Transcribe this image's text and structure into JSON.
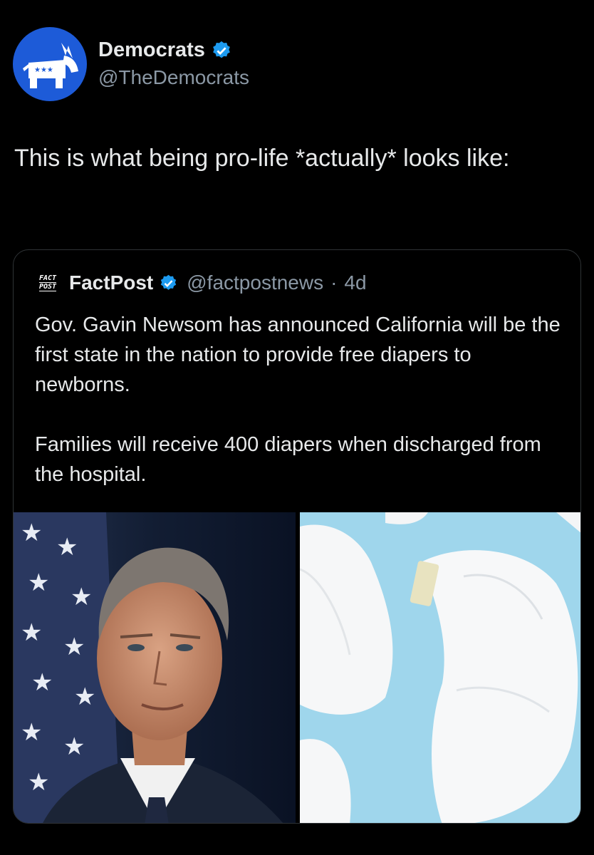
{
  "author": {
    "display_name": "Democrats",
    "handle": "@TheDemocrats",
    "verified": true,
    "avatar_icon": "donkey-logo-icon",
    "avatar_color": "#1d5bd8"
  },
  "tweet": {
    "text": "This is what being pro-life *actually* looks like:"
  },
  "quote": {
    "logo_lines": [
      "FACT",
      "POST"
    ],
    "display_name": "FactPost",
    "handle": "@factpostnews",
    "separator": "·",
    "time": "4d",
    "paragraphs": [
      "Gov. Gavin Newsom has announced California will be the first state in the nation to provide free diapers to newborns.",
      "Families will receive 400 diapers when discharged from the hospital."
    ]
  },
  "colors": {
    "background": "#000000",
    "text": "#e7e9ea",
    "secondary_text": "#8b98a5",
    "verified": "#1d9bf0",
    "border": "#2f3336"
  }
}
